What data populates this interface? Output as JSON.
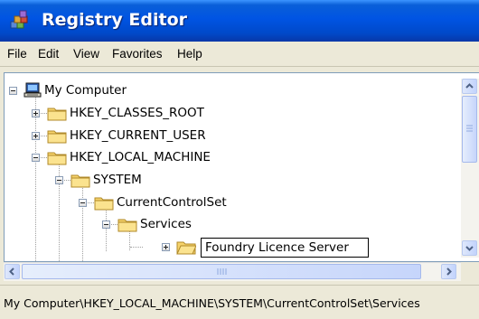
{
  "window": {
    "title": "Registry Editor"
  },
  "menu": [
    "File",
    "Edit",
    "View",
    "Favorites",
    "Help"
  ],
  "tree": {
    "root": "My Computer",
    "hives": [
      "HKEY_CLASSES_ROOT",
      "HKEY_CURRENT_USER",
      "HKEY_LOCAL_MACHINE"
    ],
    "system": "SYSTEM",
    "current_control_set": "CurrentControlSet",
    "services": "Services",
    "new_key_name": "Foundry Licence Server"
  },
  "status_bar": {
    "path": "My Computer\\HKEY_LOCAL_MACHINE\\SYSTEM\\CurrentControlSet\\Services"
  }
}
